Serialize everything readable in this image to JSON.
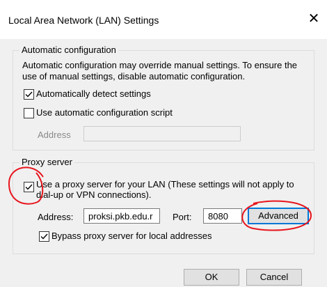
{
  "window": {
    "title": "Local Area Network (LAN) Settings",
    "close_glyph": "✕"
  },
  "automatic": {
    "legend": "Automatic configuration",
    "description_line1": "Automatic configuration may override manual settings.  To ensure the",
    "description_line2": "use of manual settings, disable automatic configuration.",
    "detect_label": "Automatically detect settings",
    "detect_checked": true,
    "script_label": "Use automatic configuration script",
    "script_checked": false,
    "address_label": "Address",
    "address_value": ""
  },
  "proxy": {
    "legend": "Proxy server",
    "use_proxy_line1": "Use a proxy server for your LAN (These settings will not apply to",
    "use_proxy_line2": "dial-up or VPN connections).",
    "use_proxy_checked": true,
    "address_label": "Address:",
    "address_value": "proksi.pkb.edu.r",
    "port_label": "Port:",
    "port_value": "8080",
    "advanced_label": "Advanced",
    "bypass_label": "Bypass proxy server for local addresses",
    "bypass_checked": true
  },
  "buttons": {
    "ok": "OK",
    "cancel": "Cancel"
  },
  "colors": {
    "annotation_red": "#e8141c",
    "focus_blue": "#0078d7",
    "window_bg": "#f0f0f0"
  },
  "icons": {
    "close": "close-icon",
    "check": "checkmark-icon"
  }
}
